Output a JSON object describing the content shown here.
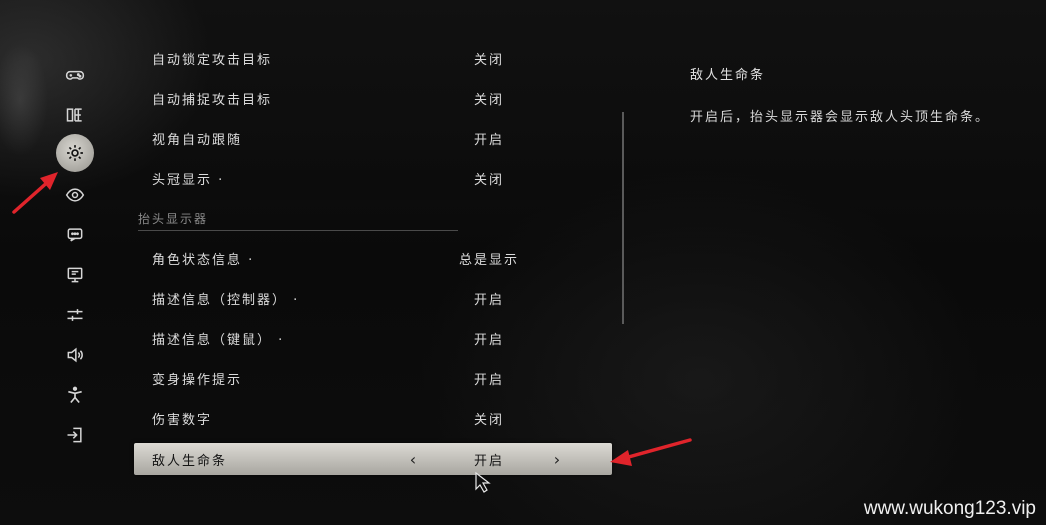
{
  "sidebar": {
    "items": [
      {
        "icon": "gamepad-icon",
        "active": false
      },
      {
        "icon": "skill-tree-icon",
        "active": false
      },
      {
        "icon": "gear-icon",
        "active": true
      },
      {
        "icon": "eye-icon",
        "active": false
      },
      {
        "icon": "chat-icon",
        "active": false
      },
      {
        "icon": "monitor-icon",
        "active": false
      },
      {
        "icon": "sliders-icon",
        "active": false
      },
      {
        "icon": "speaker-icon",
        "active": false
      },
      {
        "icon": "accessibility-icon",
        "active": false
      },
      {
        "icon": "exit-icon",
        "active": false
      }
    ]
  },
  "settings": {
    "top_rows": [
      {
        "label": "自动锁定攻击目标",
        "value": "关闭"
      },
      {
        "label": "自动捕捉攻击目标",
        "value": "关闭"
      },
      {
        "label": "视角自动跟随",
        "value": "开启"
      },
      {
        "label": "头冠显示 ·",
        "value": "关闭"
      }
    ],
    "section_title": "抬头显示器",
    "hud_rows": [
      {
        "label": "角色状态信息 ·",
        "value": "总是显示"
      },
      {
        "label": "描述信息（控制器） ·",
        "value": "开启"
      },
      {
        "label": "描述信息（键鼠） ·",
        "value": "开启"
      },
      {
        "label": "变身操作提示",
        "value": "开启"
      },
      {
        "label": "伤害数字",
        "value": "关闭"
      }
    ],
    "selected_row": {
      "label": "敌人生命条",
      "value": "开启",
      "prev_symbol": "‹",
      "next_symbol": "›"
    }
  },
  "info_panel": {
    "title": "敌人生命条",
    "description": "开启后，抬头显示器会显示敌人头顶生命条。"
  },
  "watermark": "www.wukong123.vip",
  "colors": {
    "annotation_arrow": "#e0242b",
    "selected_row_bg": "#c2c0ba",
    "text": "#dcdcdc"
  }
}
